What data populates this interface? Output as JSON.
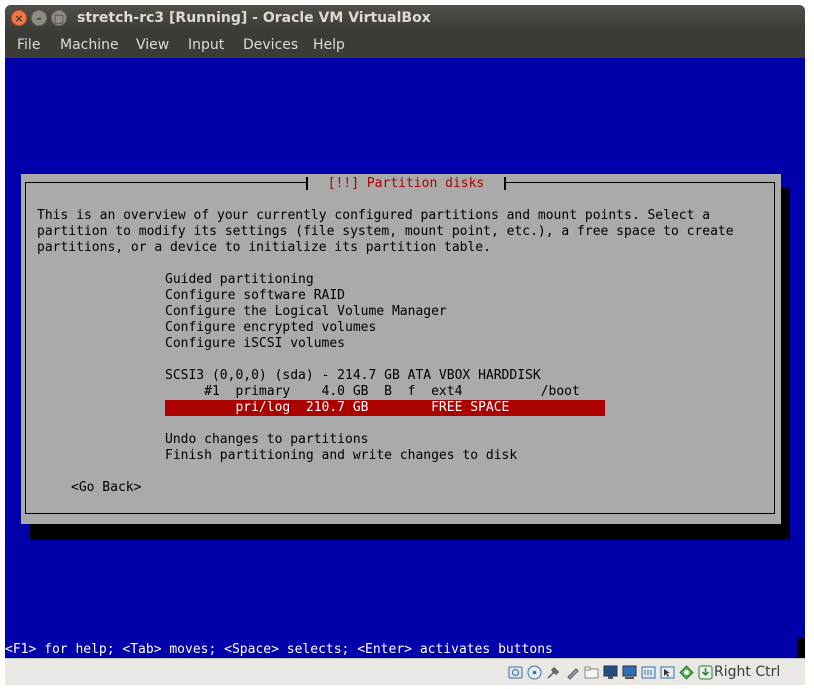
{
  "window": {
    "title": "stretch-rc3 [Running] - Oracle VM VirtualBox",
    "buttons": {
      "close": "×",
      "minimize": "–",
      "maximize": "□"
    }
  },
  "menu": [
    "File",
    "Machine",
    "View",
    "Input",
    "Devices",
    "Help"
  ],
  "dialog": {
    "title": "[!!] Partition disks",
    "intro": [
      "This is an overview of your currently configured partitions and mount points. Select a",
      "partition to modify its settings (file system, mount point, etc.), a free space to create",
      "partitions, or a device to initialize its partition table."
    ],
    "options": [
      "Guided partitioning",
      "Configure software RAID",
      "Configure the Logical Volume Manager",
      "Configure encrypted volumes",
      "Configure iSCSI volumes"
    ],
    "disk": "SCSI3 (0,0,0) (sda) - 214.7 GB ATA VBOX HARDDISK",
    "partitions": [
      "     #1  primary    4.0 GB  B  f  ext4          /boot",
      "         pri/log  210.7 GB        FREE SPACE"
    ],
    "actions": [
      "Undo changes to partitions",
      "Finish partitioning and write changes to disk"
    ],
    "back": "<Go Back>"
  },
  "status_line": "<F1> for help; <Tab> moves; <Space> selects; <Enter> activates buttons",
  "statusbar": {
    "icons": [
      "hard-disk-icon",
      "optical-drive-icon",
      "usb-icon",
      "audio-icon",
      "shared-folder-icon",
      "display-icon",
      "video-capture-icon",
      "network-icon",
      "mouse-integration-icon",
      "keyboard-capture-icon"
    ],
    "host_key": "Right Ctrl"
  }
}
